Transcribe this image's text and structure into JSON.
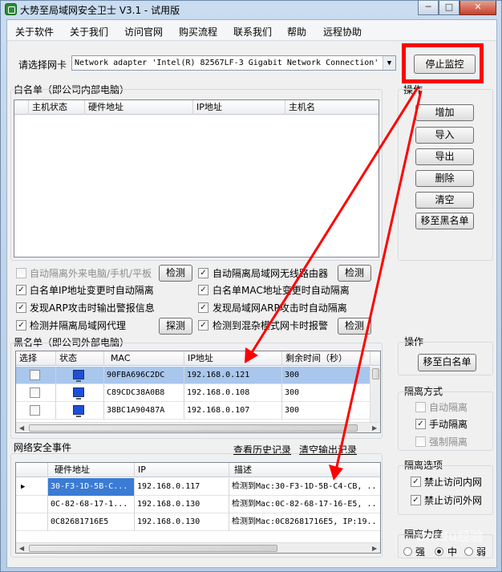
{
  "window": {
    "title": "大势至局域网安全卫士 V3.1 - 试用版",
    "min": "─",
    "max": "□",
    "close": "✕"
  },
  "menu": [
    "关于软件",
    "关于我们",
    "访问官网",
    "购买流程",
    "联系我们",
    "帮助",
    "远程协助"
  ],
  "adapter": {
    "label": "请选择网卡",
    "value": "Network adapter 'Intel(R) 82567LF-3 Gigabit Network Connection'",
    "stop_button": "停止监控"
  },
  "whitelist": {
    "title": "白名单（即公司内部电脑）",
    "columns": [
      "主机状态",
      "硬件地址",
      "IP地址",
      "主机名"
    ]
  },
  "ops": {
    "title": "操作",
    "buttons": [
      "增加",
      "导入",
      "导出",
      "删除",
      "清空",
      "移至黑名单"
    ]
  },
  "options": [
    {
      "label": "自动隔离外来电脑/手机/平板",
      "checked": false,
      "disabled": true,
      "button": "检测"
    },
    {
      "label": "自动隔离局域网无线路由器",
      "checked": true,
      "disabled": false,
      "button": "检测"
    },
    {
      "label": "白名单IP地址变更时自动隔离",
      "checked": true,
      "disabled": false,
      "button": ""
    },
    {
      "label": "白名单MAC地址变更时自动隔离",
      "checked": true,
      "disabled": false,
      "button": ""
    },
    {
      "label": "发现ARP攻击时输出警报信息",
      "checked": true,
      "disabled": false,
      "button": ""
    },
    {
      "label": "发现局域网ARP攻击时自动隔离",
      "checked": true,
      "disabled": false,
      "button": ""
    },
    {
      "label": "检测并隔离局域网代理",
      "checked": true,
      "disabled": false,
      "button": "探测"
    },
    {
      "label": "检测到混杂模式网卡时报警",
      "checked": true,
      "disabled": false,
      "button": "检测"
    }
  ],
  "blacklist": {
    "title": "黑名单（即公司外部电脑）",
    "columns": [
      "选择",
      "状态",
      "MAC",
      "IP地址",
      "剩余时间（秒）"
    ],
    "rows": [
      {
        "mac": "90FBA696C2DC",
        "ip": "192.168.0.121",
        "time": "300",
        "selected": true
      },
      {
        "mac": "C89CDC38A0B8",
        "ip": "192.168.0.108",
        "time": "300",
        "selected": false
      },
      {
        "mac": "38BC1A90487A",
        "ip": "192.168.0.107",
        "time": "300",
        "selected": false
      }
    ]
  },
  "ops2": {
    "title": "操作",
    "button": "移至白名单"
  },
  "isolation_mode": {
    "title": "隔离方式",
    "items": [
      {
        "label": "自动隔离",
        "checked": false,
        "disabled": true
      },
      {
        "label": "手动隔离",
        "checked": true,
        "disabled": false
      },
      {
        "label": "强制隔离",
        "checked": false,
        "disabled": true
      }
    ]
  },
  "events": {
    "title": "网络安全事件",
    "history_link": "查看历史记录",
    "clear_link": "清空输出记录",
    "columns": [
      "硬件地址",
      "IP",
      "描述"
    ],
    "rows": [
      {
        "mac": "30-F3-1D-5B-C...",
        "ip": "192.168.0.117",
        "desc": "检测到Mac:30-F3-1D-5B-C4-CB, ..",
        "current": true
      },
      {
        "mac": "0C-82-68-17-1...",
        "ip": "192.168.0.130",
        "desc": "检测到Mac:0C-82-68-17-16-E5, ..",
        "current": false
      },
      {
        "mac": "0C82681716E5",
        "ip": "192.168.0.130",
        "desc": "检测到Mac:0C82681716E5, IP:19..",
        "current": false
      }
    ]
  },
  "isolation_opts": {
    "title": "隔离选项",
    "items": [
      {
        "label": "禁止访问内网",
        "checked": true
      },
      {
        "label": "禁止访问外网",
        "checked": true
      }
    ]
  },
  "strength": {
    "title": "隔离力度",
    "options": [
      "强",
      "中",
      "弱"
    ],
    "selected": "中"
  },
  "watermark": "Baidu经验",
  "colors": {
    "highlight": "#ff0000",
    "selected_row": "#a9c6ec",
    "monitor": "#1f4fd6"
  }
}
